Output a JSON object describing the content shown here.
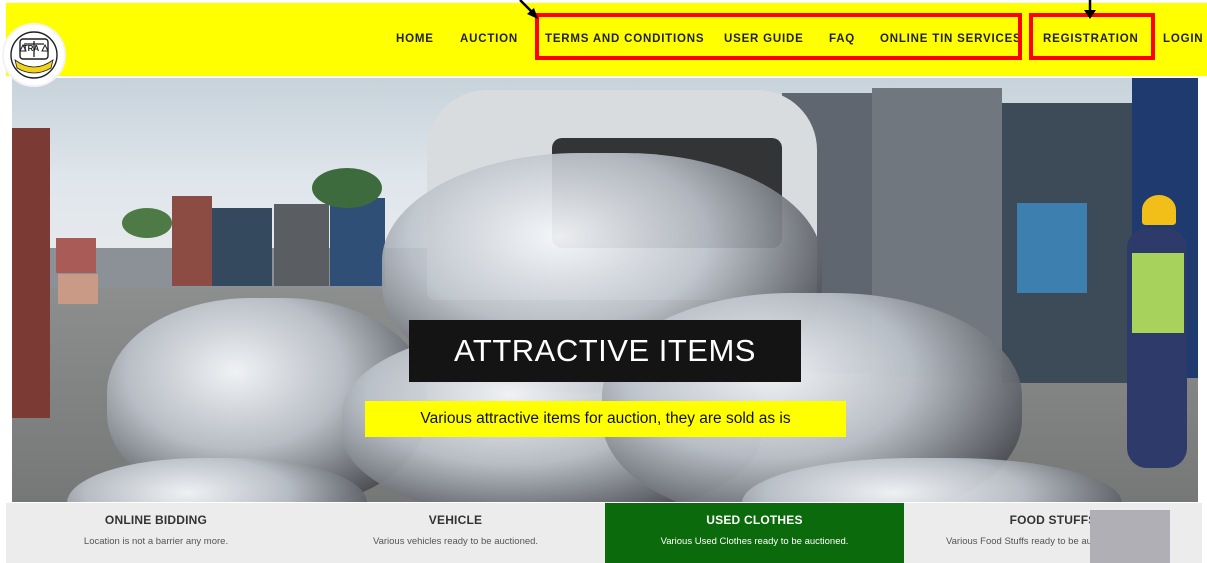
{
  "nav": {
    "items": [
      {
        "label": "HOME"
      },
      {
        "label": "AUCTION"
      },
      {
        "label": "TERMS AND CONDITIONS"
      },
      {
        "label": "USER GUIDE"
      },
      {
        "label": "FAQ"
      },
      {
        "label": "ONLINE TIN SERVICES"
      },
      {
        "label": "REGISTRATION"
      },
      {
        "label": "LOGIN"
      }
    ]
  },
  "logo": {
    "text": "TRA"
  },
  "hero": {
    "title": "ATTRACTIVE ITEMS",
    "subtitle": "Various attractive items for auction, they are sold as is"
  },
  "categories": [
    {
      "title": "ONLINE BIDDING",
      "desc": "Location is not a barrier any more."
    },
    {
      "title": "VEHICLE",
      "desc": "Various vehicles ready to be auctioned."
    },
    {
      "title": "USED CLOTHES",
      "desc": "Various Used Clothes ready to be auctioned.",
      "active": true
    },
    {
      "title": "FOOD STUFFS",
      "desc": "Various Food Stuffs ready to be au"
    }
  ],
  "colors": {
    "header_bg": "#ffff00",
    "annotation": "#ff0000",
    "active_category": "#0b6a0b"
  }
}
